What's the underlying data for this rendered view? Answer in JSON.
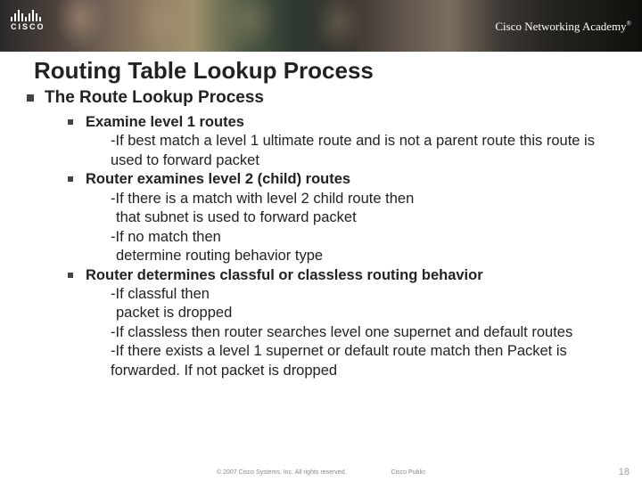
{
  "brand": {
    "logo_text": "CISCO",
    "academy_text": "Cisco Networking Academy",
    "tm": "®"
  },
  "title": "Routing Table Lookup Process",
  "level1_heading": "The Route Lookup Process",
  "items": [
    {
      "head": "Examine level 1 routes",
      "subs": [
        {
          "text": "-If best match a level 1 ultimate route and is not a parent route this route is used to forward packet",
          "indent": 1
        }
      ]
    },
    {
      "head": "Router examines level 2 (child) routes",
      "subs": [
        {
          "text": "-If there is a match with level 2 child route then",
          "indent": 1
        },
        {
          "text": "that subnet is used to forward packet",
          "indent": 2
        },
        {
          "text": "-If no match then",
          "indent": 1
        },
        {
          "text": "determine routing behavior type",
          "indent": 2
        }
      ]
    },
    {
      "head": "Router determines classful or classless routing behavior",
      "subs": [
        {
          "text": "-If classful then",
          "indent": 1
        },
        {
          "text": "packet is dropped",
          "indent": 2
        },
        {
          "text": "-If classless then router searches level one supernet and default routes",
          "indent": 1
        },
        {
          "text": "-If there exists a level 1 supernet or default route   match then Packet is forwarded.  If not packet is dropped",
          "indent": 1
        }
      ]
    }
  ],
  "footer": {
    "copyright": "© 2007 Cisco Systems, Inc. All rights reserved.",
    "classification": "Cisco Public"
  },
  "page_number": "18"
}
